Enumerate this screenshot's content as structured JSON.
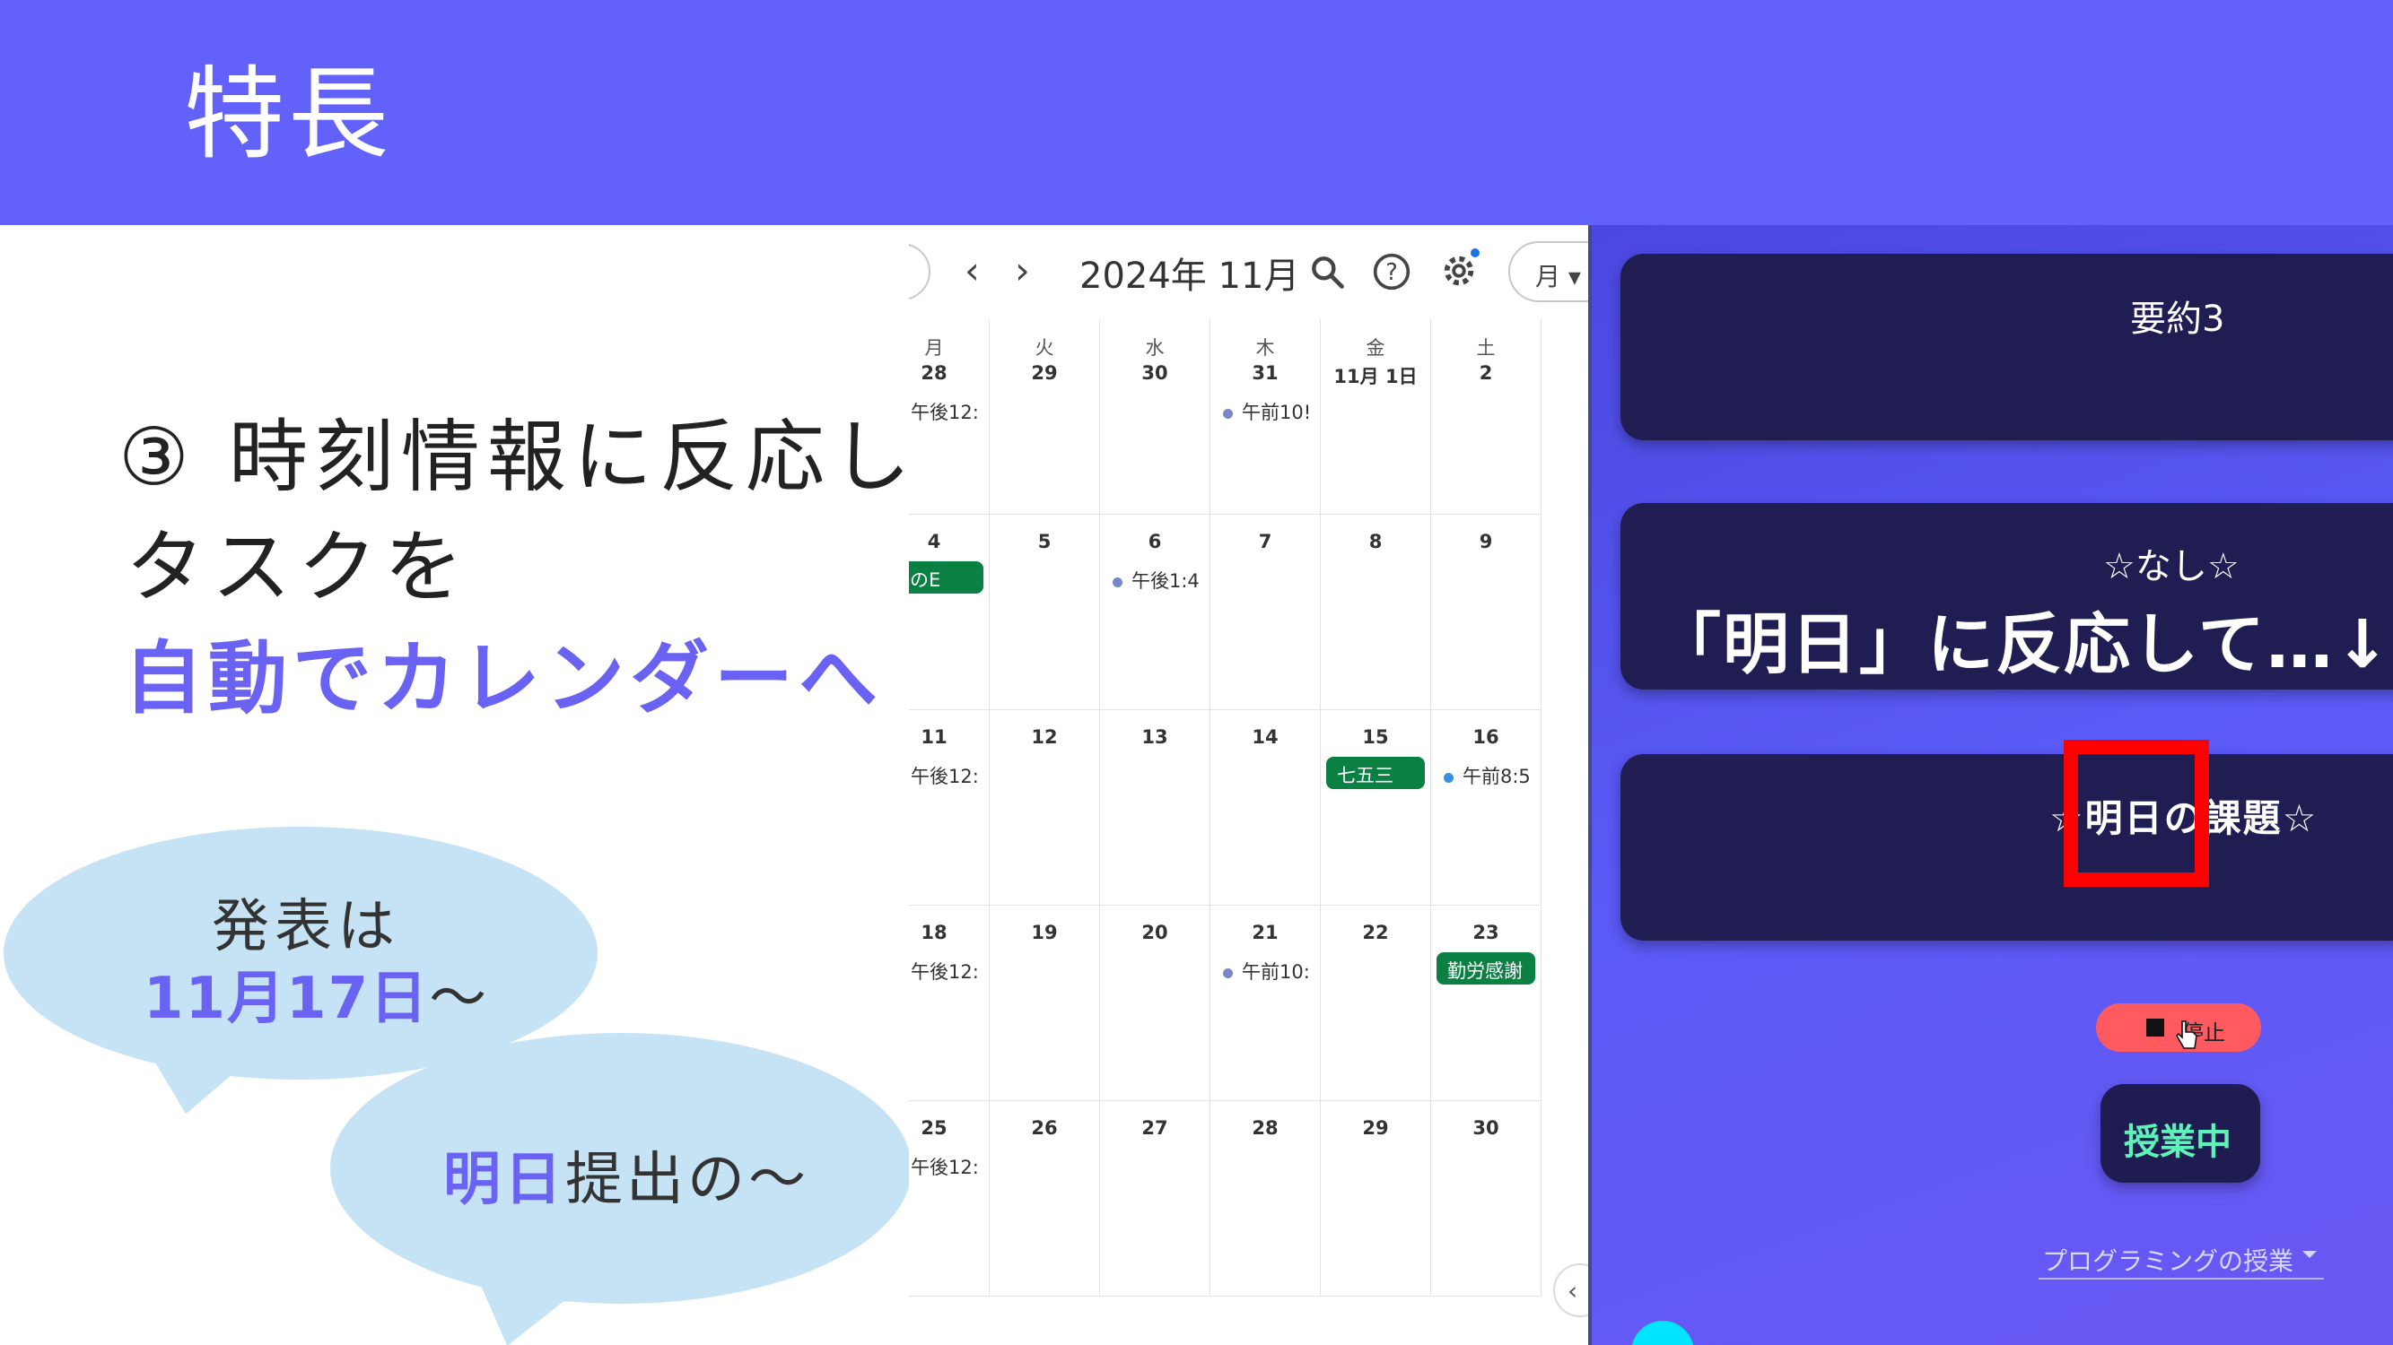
{
  "slide": {
    "title": "特長",
    "line1": "③ 時刻情報に反応し、",
    "line2": "タスクを",
    "line3": "自動でカレンダーへ",
    "bubble1": {
      "top": "発表は",
      "date": "11月17日",
      "suffix": "〜"
    },
    "bubble2": {
      "highlight": "明日",
      "rest": "提出の〜"
    }
  },
  "calendar": {
    "prev": "‹",
    "next": "›",
    "month": "2024年 11月",
    "view": "月 ▾",
    "weekdays": [
      "月",
      "火",
      "水",
      "木",
      "金",
      "土"
    ],
    "rows": [
      [
        "28",
        "29",
        "30",
        "31",
        "11月 1日",
        "2"
      ],
      [
        "4",
        "5",
        "6",
        "7",
        "8",
        "9"
      ],
      [
        "11",
        "12",
        "13",
        "14",
        "15",
        "16"
      ],
      [
        "18",
        "19",
        "20",
        "21",
        "22",
        "23"
      ],
      [
        "25",
        "26",
        "27",
        "28",
        "29",
        "30"
      ]
    ],
    "events": {
      "r0c0": "午後12:",
      "r0c3": "午前10!",
      "r1c0": "文化のE",
      "r1c2": "午後1:4",
      "r2c0": "午後12:",
      "r2c4": "七五三",
      "r2c5": "午前8:5",
      "r3c0": "午後12:",
      "r3c3": "午前10:",
      "r3c5": "勤労感謝",
      "r4c0": "午後12:"
    },
    "collapse": "‹",
    "colors": {
      "event_dot": "#7986cb",
      "holiday_chip": "#0b8043"
    }
  },
  "app": {
    "card1": "要約3",
    "card2_sub": "☆なし☆",
    "card2_main": "「明日」に反応して…↓",
    "card3": "☆明日の課題☆",
    "stop": "停止",
    "status": "授業中",
    "course": "プログラミングの授業",
    "colors": {
      "highlight_box": "#ff0000",
      "status_text": "#5ef2b8"
    }
  }
}
